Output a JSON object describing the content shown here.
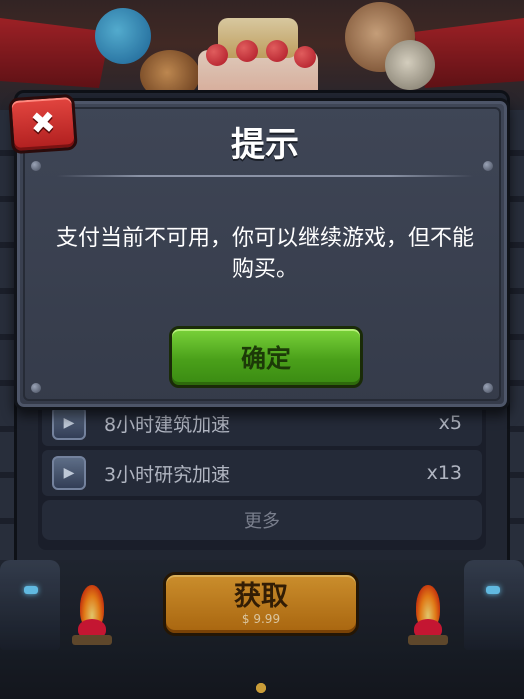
{
  "dialog": {
    "title": "提示",
    "message": "支付当前不可用，你可以继续游戏，但不能购买。",
    "confirm_label": "确定"
  },
  "shop_list": {
    "items": [
      {
        "label": "8小时建筑加速",
        "quantity": "x5",
        "icon": "speedup-icon"
      },
      {
        "label": "3小时研究加速",
        "quantity": "x13",
        "icon": "speedup-icon"
      }
    ],
    "more_label": "更多"
  },
  "purchase": {
    "label": "获取",
    "price": "$ 9.99"
  },
  "colors": {
    "confirm_green": "#4aa01a",
    "close_red": "#b01f1f",
    "get_orange": "#d88a22",
    "panel": "#3a4050"
  }
}
